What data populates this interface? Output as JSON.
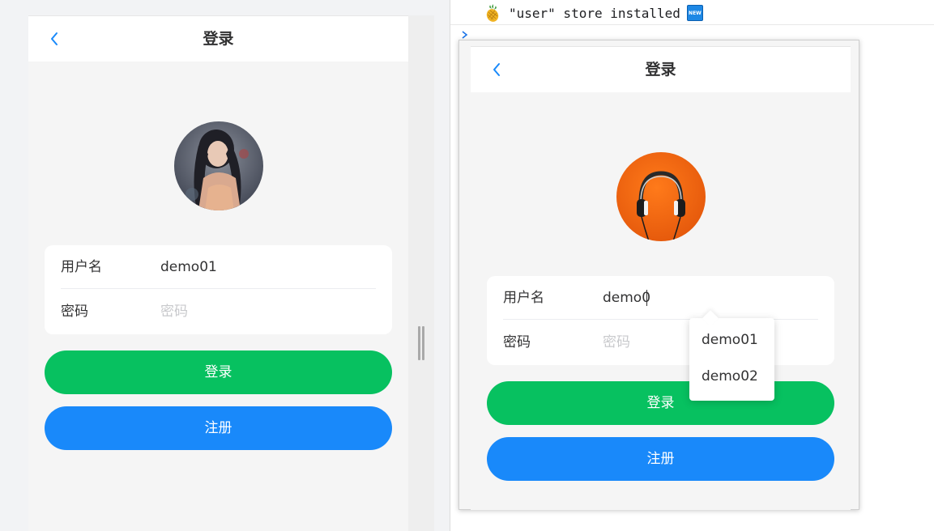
{
  "console": {
    "message": "\"user\" store installed",
    "badge": "NEW"
  },
  "left_app": {
    "nav": {
      "title": "登录"
    },
    "form": {
      "username_label": "用户名",
      "username_value": "demo01",
      "password_label": "密码",
      "password_placeholder": "密码"
    },
    "buttons": {
      "login": "登录",
      "register": "注册"
    }
  },
  "right_app": {
    "nav": {
      "title": "登录"
    },
    "form": {
      "username_label": "用户名",
      "username_value": "demo0",
      "password_label": "密码",
      "password_placeholder": "密码"
    },
    "suggestions": [
      "demo01",
      "demo02"
    ],
    "buttons": {
      "login": "登录",
      "register": "注册"
    }
  },
  "colors": {
    "login_button": "#07c160",
    "register_button": "#1989fa",
    "accent_back": "#1989fa",
    "page_bg": "#f5f5f5"
  }
}
